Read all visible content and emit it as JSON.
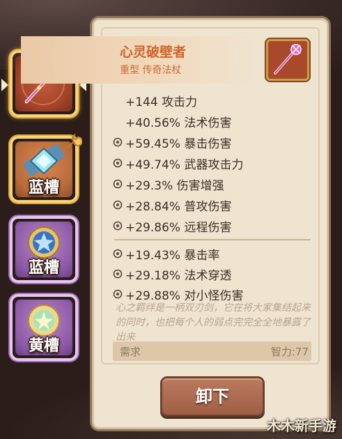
{
  "item": {
    "name": "心灵破壁者",
    "type": "重型 传奇法杖",
    "icon": "staff-icon"
  },
  "base_stats": [
    {
      "text": "+144 攻击力",
      "has_icon": false
    },
    {
      "text": "+40.56% 法术伤害",
      "has_icon": false
    },
    {
      "text": "+59.45% 暴击伤害",
      "has_icon": true
    },
    {
      "text": "+49.74% 武器攻击力",
      "has_icon": true
    },
    {
      "text": "+29.3% 伤害增强",
      "has_icon": true
    },
    {
      "text": "+28.84% 普攻伤害",
      "has_icon": true
    },
    {
      "text": "+29.86% 远程伤害",
      "has_icon": true
    }
  ],
  "extra_stats": [
    {
      "text": "+19.43% 暴击率",
      "has_icon": true
    },
    {
      "text": "+29.18% 法术穿透",
      "has_icon": true
    },
    {
      "text": "+29.88% 对小怪伤害",
      "has_icon": true
    }
  ],
  "lore": "心之羁绊是一柄双刃剑，它在将大家集结起来的同时，也把每个人的弱点完完全全地暴露了出来",
  "requirement": {
    "label": "需求",
    "value": "智力:77"
  },
  "unequip_label": "卸下",
  "slots": [
    {
      "label": "",
      "icon": "staff-icon",
      "selected": true
    },
    {
      "label": "蓝槽",
      "icon": "blue-gem-icon"
    },
    {
      "label": "蓝槽",
      "icon": "blue-gem-icon"
    },
    {
      "label": "黄槽",
      "icon": "yellow-gem-icon"
    }
  ],
  "watermark": "木木新手游",
  "colors": {
    "item_name": "#d0642a",
    "panel": "#efe4d0",
    "button": "#a9694f"
  }
}
